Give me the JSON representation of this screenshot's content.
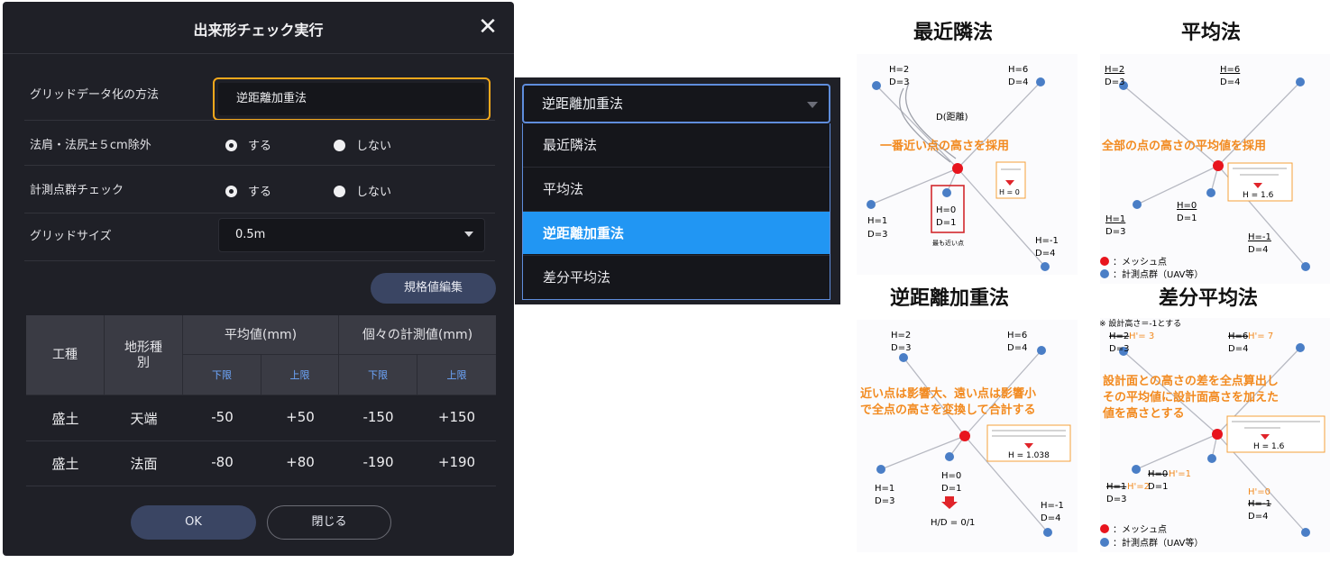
{
  "dialog": {
    "title": "出来形チェック実行",
    "close_glyph": "✕",
    "rows": {
      "method_label": "グリッドデータ化の方法",
      "method_value": "逆距離加重法",
      "shoulder_label": "法肩・法尻±５cm除外",
      "shoulder_opt_yes": "する",
      "shoulder_opt_no": "しない",
      "check_label": "計測点群チェック",
      "check_opt_yes": "する",
      "check_opt_no": "しない",
      "grid_label": "グリッドサイズ",
      "grid_value": "0.5m"
    },
    "spec_edit_button": "規格値編集",
    "table": {
      "col_type": "工種",
      "col_terrain": "地形種別",
      "col_avg": "平均値(mm)",
      "col_each": "個々の計測値(mm)",
      "sub_lower": "下限",
      "sub_upper": "上限",
      "rows": [
        {
          "type": "盛土",
          "terrain": "天端",
          "avg_low": "-50",
          "avg_up": "+50",
          "each_low": "-150",
          "each_up": "+150"
        },
        {
          "type": "盛土",
          "terrain": "法面",
          "avg_low": "-80",
          "avg_up": "+80",
          "each_low": "-190",
          "each_up": "+190"
        }
      ]
    },
    "ok_button": "OK",
    "close_button": "閉じる"
  },
  "dropdown": {
    "selected": "逆距離加重法",
    "options": [
      "最近隣法",
      "平均法",
      "逆距離加重法",
      "差分平均法"
    ],
    "active_index": 2
  },
  "illustration": {
    "titles": [
      "最近隣法",
      "平均法",
      "逆距離加重法",
      "差分平均法"
    ],
    "nearest": {
      "p1": "H=2",
      "p1d": "D=3",
      "p2": "H=6",
      "p2d": "D=4",
      "p3": "H=1",
      "p3d": "D=3",
      "p4": "H=-1",
      "p4d": "D=4",
      "center": "H=0",
      "centerd": "D=1",
      "dist": "D(距離)",
      "caption": "一番近い点の高さを採用",
      "near_note": "最も近い点",
      "result": "H = 0"
    },
    "average": {
      "p1": "H=2",
      "p1d": "D=3",
      "p2": "H=6",
      "p2d": "D=4",
      "p3": "H=1",
      "p3d": "D=3",
      "p4": "H=-1",
      "p4d": "D=4",
      "center": "H=0",
      "centerd": "D=1",
      "caption": "全部の点の高さの平均値を採用",
      "result": "H = 1.6",
      "legend_mesh": "：メッシュ点",
      "legend_cloud": "：計測点群（UAV等）"
    },
    "idw": {
      "p1": "H=2",
      "p1d": "D=3",
      "p2": "H=6",
      "p2d": "D=4",
      "p3": "H=1",
      "p3d": "D=3",
      "p4": "H=-1",
      "p4d": "D=4",
      "center": "H=0",
      "centerd": "D=1",
      "caption1": "近い点は影響大、遠い点は影響小",
      "caption2": "で全点の高さを変換して合計する",
      "result": "H = 1.038",
      "hd": "H/D = 0/1"
    },
    "diff": {
      "note": "※ 設計高さ＝-1とする",
      "p1": "H=2",
      "p1h": "H'= 3",
      "p1d": "D=3",
      "p2": "H=6",
      "p2h": "H'= 7",
      "p2d": "D=4",
      "p3": "H=1",
      "p3h": "H'=2",
      "p3d": "D=3",
      "p4": "H=-1",
      "p4h": "H'=0",
      "p4d": "D=4",
      "center": "H=0",
      "centerh": "H'=1",
      "centerd": "D=1",
      "caption1": "設計面との高さの差を全点算出し",
      "caption2": "その平均値に設計面高さを加えた",
      "caption3": "値を高さとする",
      "result": "H = 1.6",
      "legend_mesh": "：メッシュ点",
      "legend_cloud": "：計測点群（UAV等）"
    }
  }
}
